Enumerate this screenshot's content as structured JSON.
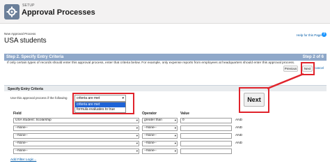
{
  "header": {
    "setup_label": "SETUP",
    "title": "Approval Processes"
  },
  "page": {
    "breadcrumb": "New Approval Process",
    "record_title": "USA students",
    "help_link": "Help for this Page",
    "help_icon": "?"
  },
  "step": {
    "title": "Step 2. Specify Entry Criteria",
    "count": "Step 2 of 6"
  },
  "intro_text": "If only certain types of records should enter this approval process, enter that criteria below. For example, only expense reports from employees at headquarters should enter this approval process.",
  "nav_buttons": {
    "previous": "Previous",
    "next": "Next",
    "cancel": "Cancel"
  },
  "section": {
    "title": "Specify Entry Criteria",
    "use_label": "Use this approval process if the following"
  },
  "criteria": {
    "selected": "criteria are met",
    "options": [
      "criteria are met",
      "formula evaluates to true"
    ]
  },
  "filter_table": {
    "headers": {
      "field": "Field",
      "operator": "Operator",
      "value": "Value"
    },
    "rows": [
      {
        "field": "USA student: Scolarship",
        "operator": "greater than",
        "value": "0",
        "connector": "AND"
      },
      {
        "field": "--None--",
        "operator": "--None--",
        "value": "",
        "connector": "AND"
      },
      {
        "field": "--None--",
        "operator": "--None--",
        "value": "",
        "connector": "AND"
      },
      {
        "field": "--None--",
        "operator": "--None--",
        "value": "",
        "connector": "AND"
      },
      {
        "field": "--None--",
        "operator": "--None--",
        "value": "",
        "connector": ""
      }
    ]
  },
  "add_filter_logic": "Add Filter Logic...",
  "callout": {
    "next_label": "Next"
  },
  "colors": {
    "highlight": "#e0232b",
    "step_bar": "#8fa8c9",
    "link": "#015ba7"
  },
  "icons": {
    "header_icon": "gear-icon",
    "caret": "chevron-down-icon"
  }
}
